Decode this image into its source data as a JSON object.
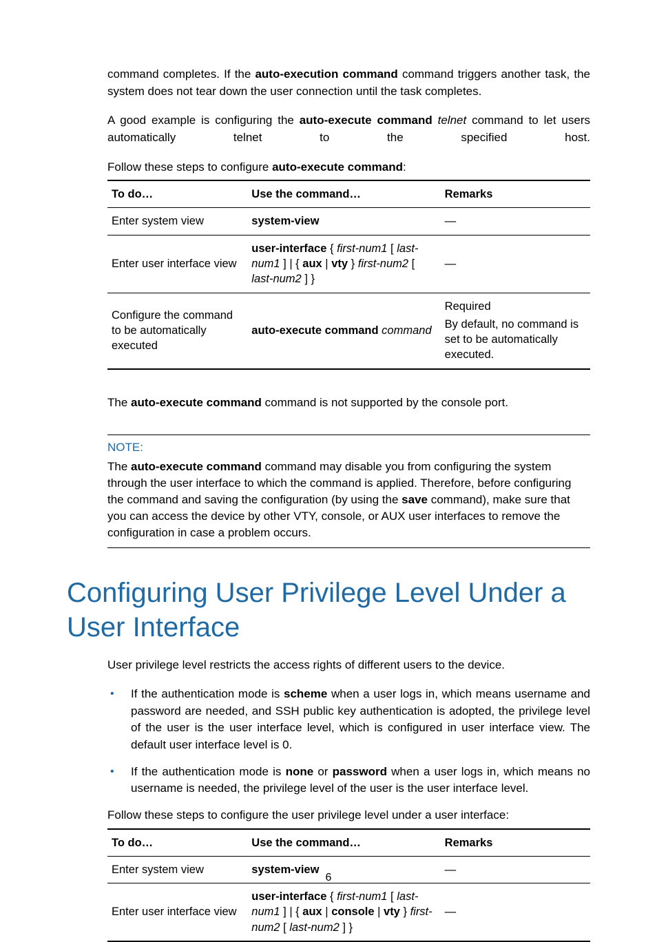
{
  "intro": {
    "p1_a": "command completes. If the ",
    "p1_b": "auto-execution command",
    "p1_c": " command triggers another task, the system does not tear down the user connection until the task completes.",
    "p2_a": "A good example is configuring the ",
    "p2_b": "auto-execute command",
    "p2_c": " ",
    "p2_d": "telnet",
    "p2_e": " command to let users automatically telnet to the specified host.",
    "p3_a": "Follow these steps to configure ",
    "p3_b": "auto-execute command",
    "p3_c": ":"
  },
  "table1": {
    "head": {
      "c1": "To do…",
      "c2": "Use the command…",
      "c3": "Remarks"
    },
    "rows": [
      {
        "c1": "Enter system view",
        "c2": {
          "b1": "system-view"
        },
        "c3": "—"
      },
      {
        "c1": "Enter user interface view",
        "c2": {
          "b1": "user-interface",
          "t1": " { ",
          "i1": "first-num1",
          "t2": " [ ",
          "i2": "last-num1",
          "t3": " ] | { ",
          "b2": "aux",
          "t4": " | ",
          "b3": "vty",
          "t5": " } ",
          "i3": "first-num2",
          "t6": " [ ",
          "i4": "last-num2",
          "t7": " ] }"
        },
        "c3": "—"
      },
      {
        "c1": "Configure the command to be automatically executed",
        "c2": {
          "b1": "auto-execute command",
          "t1": " ",
          "i1": "command"
        },
        "c3_l1": "Required",
        "c3_l2": "By default, no command is set to be automatically executed."
      }
    ]
  },
  "mid": {
    "p_a": "The ",
    "p_b": "auto-execute command",
    "p_c": " command is not supported by the console port."
  },
  "note": {
    "head": "NOTE:",
    "a": "The ",
    "b": "auto-execute command",
    "c": " command may disable you from configuring the system through the user interface to which the command is applied. Therefore, before configuring the command and saving the configuration (by using the ",
    "d": "save",
    "e": " command), make sure that you can access the device by other VTY, console, or AUX user interfaces to remove the configuration in case a problem occurs."
  },
  "section": {
    "title": "Configuring User Privilege Level Under a User Interface",
    "lead": "User privilege level restricts the access rights of different users to the device.",
    "li1_a": "If the authentication mode is ",
    "li1_b": "scheme",
    "li1_c": " when a user logs in, which means username and password are needed, and SSH public key authentication is adopted, the privilege level of the user is the user interface level, which is configured in user interface view. The default user interface level is 0.",
    "li2_a": "If the authentication mode is ",
    "li2_b": "none",
    "li2_c": " or ",
    "li2_d": "password",
    "li2_e": " when a user logs in, which means no username is needed, the privilege level of the user is the user interface level.",
    "follow": "Follow these steps to configure the user privilege level under a user interface:"
  },
  "table2": {
    "head": {
      "c1": "To do…",
      "c2": "Use the command…",
      "c3": "Remarks"
    },
    "rows": [
      {
        "c1": "Enter system view",
        "c2": {
          "b1": "system-view"
        },
        "c3": "—"
      },
      {
        "c1": "Enter user interface view",
        "c2": {
          "b1": "user-interface",
          "t1": " { ",
          "i1": "first-num1",
          "t2": " [ ",
          "i2": "last-num1",
          "t3": " ] | { ",
          "b2": "aux",
          "t4": " | ",
          "b3": "console",
          "t5": " | ",
          "b4": "vty",
          "t6": " } ",
          "i3": "first-num2",
          "t7": " [ ",
          "i4": "last-num2",
          "t8": " ] }"
        },
        "c3": "—"
      }
    ]
  },
  "pagenum": "6"
}
